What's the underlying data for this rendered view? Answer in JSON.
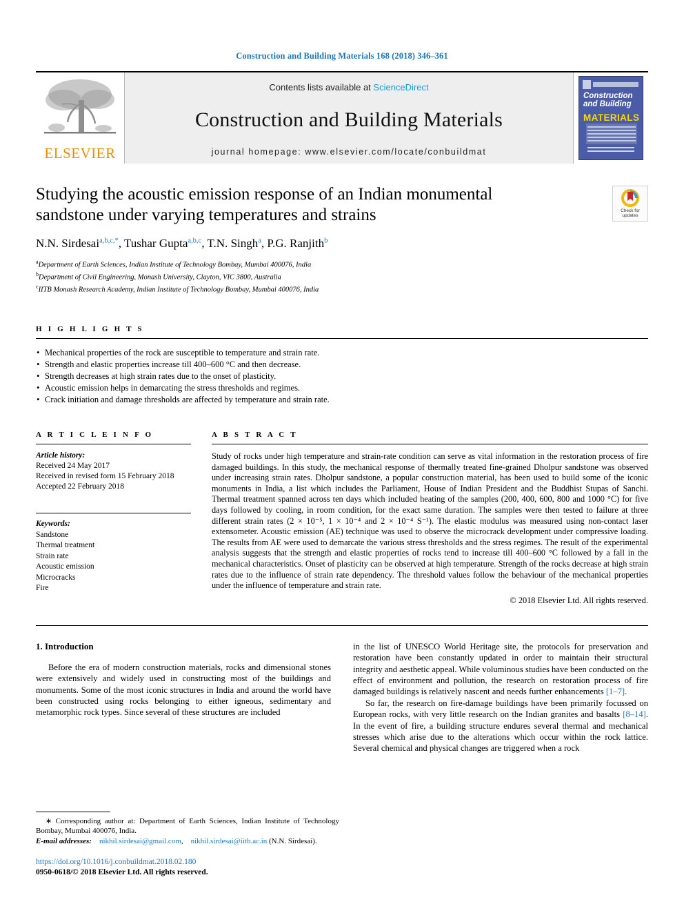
{
  "running_head": "Construction and Building Materials 168 (2018) 346–361",
  "masthead": {
    "publisher": "ELSEVIER",
    "contents_prefix": "Contents lists available at ",
    "contents_link": "ScienceDirect",
    "journal_title": "Construction and Building Materials",
    "homepage": "journal homepage: www.elsevier.com/locate/conbuildmat",
    "cover": {
      "line1": "Construction",
      "line2": "and Building",
      "line3": "MATERIALS"
    }
  },
  "article": {
    "title": "Studying the acoustic emission response of an Indian monumental sandstone under varying temperatures and strains",
    "authors": [
      {
        "name": "N.N. Sirdesai",
        "sup": "a,b,c,*"
      },
      {
        "name": "Tushar Gupta",
        "sup": "a,b,c"
      },
      {
        "name": "T.N. Singh",
        "sup": "a"
      },
      {
        "name": "P.G. Ranjith",
        "sup": "b"
      }
    ],
    "affiliations": [
      {
        "marker": "a",
        "text": "Department of Earth Sciences, Indian Institute of Technology Bombay, Mumbai 400076, India"
      },
      {
        "marker": "b",
        "text": "Department of Civil Engineering, Monash University, Clayton, VIC 3800, Australia"
      },
      {
        "marker": "c",
        "text": "IITB Monash Research Academy, Indian Institute of Technology Bombay, Mumbai 400076, India"
      }
    ],
    "crossmark_label_line1": "Check for",
    "crossmark_label_line2": "updates"
  },
  "highlights": {
    "heading": "H I G H L I G H T S",
    "items": [
      "Mechanical properties of the rock are susceptible to temperature and strain rate.",
      "Strength and elastic properties increase till 400–600 °C and then decrease.",
      "Strength decreases at high strain rates due to the onset of plasticity.",
      "Acoustic emission helps in demarcating the stress thresholds and regimes.",
      "Crack initiation and damage thresholds are affected by temperature and strain rate."
    ]
  },
  "article_info": {
    "heading": "A R T I C L E   I N F O",
    "history_label": "Article history:",
    "history": [
      "Received 24 May 2017",
      "Received in revised form 15 February 2018",
      "Accepted 22 February 2018"
    ],
    "keywords_label": "Keywords:",
    "keywords": [
      "Sandstone",
      "Thermal treatment",
      "Strain rate",
      "Acoustic emission",
      "Microcracks",
      "Fire"
    ]
  },
  "abstract": {
    "heading": "A B S T R A C T",
    "text": "Study of rocks under high temperature and strain-rate condition can serve as vital information in the restoration process of fire damaged buildings. In this study, the mechanical response of thermally treated fine-grained Dholpur sandstone was observed under increasing strain rates. Dholpur sandstone, a popular construction material, has been used to build some of the iconic monuments in India, a list which includes the Parliament, House of Indian President and the Buddhist Stupas of Sanchi. Thermal treatment spanned across ten days which included heating of the samples (200, 400, 600, 800 and 1000 °C) for five days followed by cooling, in room condition, for the exact same duration. The samples were then tested to failure at three different strain rates (2 × 10⁻⁵, 1 × 10⁻⁴ and 2 × 10⁻⁴ S⁻¹). The elastic modulus was measured using non-contact laser extensometer. Acoustic emission (AE) technique was used to observe the microcrack development under compressive loading. The results from AE were used to demarcate the various stress thresholds and the stress regimes. The result of the experimental analysis suggests that the strength and elastic properties of rocks tend to increase till 400–600 °C followed by a fall in the mechanical characteristics. Onset of plasticity can be observed at high temperature. Strength of the rocks decrease at high strain rates due to the influence of strain rate dependency. The threshold values follow the behaviour of the mechanical properties under the influence of temperature and strain rate.",
    "copyright": "© 2018 Elsevier Ltd. All rights reserved."
  },
  "introduction": {
    "heading": "1. Introduction",
    "left_para": "Before the era of modern construction materials, rocks and dimensional stones were extensively and widely used in constructing most of the buildings and monuments. Some of the most iconic structures in India and around the world have been constructed using rocks belonging to either igneous, sedimentary and metamorphic rock types. Since several of these structures are included",
    "right_para_1_a": "in the list of UNESCO World Heritage site, the protocols for preservation and restoration have been constantly updated in order to maintain their structural integrity and aesthetic appeal. While voluminous studies have been conducted on the effect of environment and pollution, the research on restoration process of fire damaged buildings is relatively nascent and needs further enhancements ",
    "right_para_1_ref": "[1–7]",
    "right_para_1_b": ".",
    "right_para_2_a": "So far, the research on fire-damage buildings have been primarily focussed on European rocks, with very little research on the Indian granites and basalts ",
    "right_para_2_ref": "[8–14]",
    "right_para_2_b": ". In the event of fire, a building structure endures several thermal and mechanical stresses which arise due to the alterations which occur within the rock lattice. Several chemical and physical changes are triggered when a rock"
  },
  "footnote": {
    "corresponding": "∗ Corresponding author at: Department of Earth Sciences, Indian Institute of Technology Bombay, Mumbai 400076, India.",
    "email_label": "E-mail addresses:",
    "email_1": "nikhil.sirdesai@gmail.com",
    "email_sep": ", ",
    "email_2": "nikhil.sirdesai@iitb.ac.in",
    "email_author": "(N.N. Sirdesai).",
    "doi": "https://doi.org/10.1016/j.conbuildmat.2018.02.180",
    "issn": "0950-0618/© 2018 Elsevier Ltd. All rights reserved."
  },
  "colors": {
    "link_blue": "#1b75bb",
    "sciencedirect_blue": "#1b9ad6",
    "elsevier_orange": "#ed8b00",
    "cover_blue": "#4a5ca8",
    "cover_yellow": "#f5d800"
  }
}
